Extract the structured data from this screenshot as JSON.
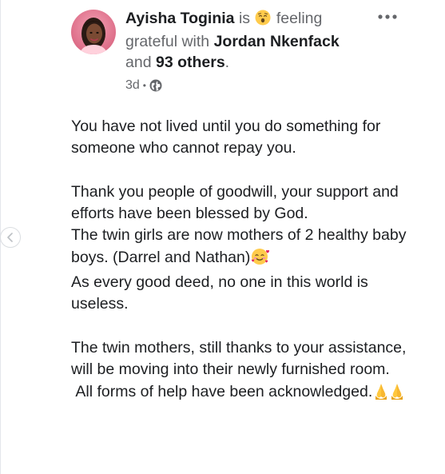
{
  "post": {
    "author": "Ayisha Toginia",
    "is_text": "is",
    "feeling_text": "feeling grateful with",
    "tagged_person": "Jordan Nkenfack",
    "and_text": "and",
    "others_text": "93 others",
    "period": ".",
    "time": "3d",
    "separator": "•",
    "audience_icon": "globe-icon",
    "feeling_emoji_icon": "relieved-face-emoji",
    "more_icon": "more-dots-icon",
    "body": {
      "p1": "You have not lived until you do something for someone who cannot repay you.",
      "p2_line1": "Thank you people of goodwill, your support and efforts have been blessed by God.",
      "p2_line2a": "The twin girls are now mothers of 2 healthy baby boys. (Darrel and Nathan)",
      "p2_line2_emoji": "smiling-face-with-hearts-emoji",
      "p2_line3": "As every good deed, no one in this world is useless.",
      "p3_line1": "The twin mothers, still thanks to your assistance, will be moving into their newly furnished room.",
      "p3_line2": " All forms of help have been acknowledged.",
      "p3_line2_emoji": "folded-hands-emoji"
    }
  },
  "nav": {
    "edge_icon": "chevron-left-icon"
  },
  "colors": {
    "text_primary": "#1c1e21",
    "text_secondary": "#65676b",
    "emoji_yellow": "#ffcb4c",
    "heart_red": "#e0245e"
  }
}
